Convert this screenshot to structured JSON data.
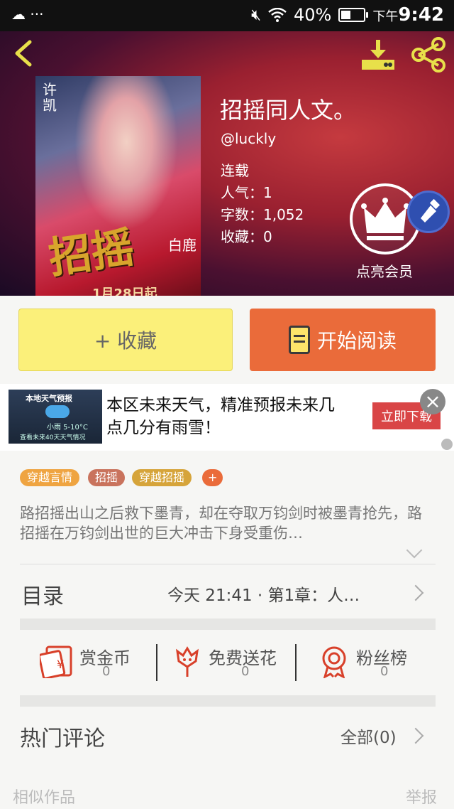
{
  "status_bar": {
    "left_icons": "☁ ···",
    "battery": "40%",
    "time_prefix": "下午",
    "time": "9:42"
  },
  "cover": {
    "title_art": "招摇",
    "date_art": "1月28日起",
    "name_left": "许凯",
    "name_right": "白鹿"
  },
  "book": {
    "title": "招摇同人文。",
    "author": "@luckly",
    "status": "连载",
    "popularity": "人气：1",
    "word_count": "字数：1,052",
    "favorites": "收藏：0"
  },
  "member": {
    "label": "点亮会员"
  },
  "actions": {
    "collect": "+  收藏",
    "read": "开始阅读"
  },
  "ad": {
    "image_title": "本地天气预报",
    "image_sub": "小雨  5-10°C",
    "image_foot": "查看未来40天天气情况",
    "text": "本区未来天气，精准预报未来几点几分有雨雪！",
    "cta": "立即下载",
    "close": "×"
  },
  "tags": [
    {
      "label": "穿越言情",
      "color": "#efa441"
    },
    {
      "label": "招摇",
      "color": "#c9735d"
    },
    {
      "label": "穿越招摇",
      "color": "#d6a43a"
    },
    {
      "label": "+",
      "color": "#ea6b3a"
    }
  ],
  "synopsis": "路招摇出山之后救下墨青，却在夺取万钧剑时被墨青抢先，路招摇在万钧剑出世的巨大冲击下身受重伤…",
  "toc": {
    "label": "目录",
    "latest": "今天 21:41 · 第1章：人…"
  },
  "stats": [
    {
      "label": "赏金币",
      "value": "0",
      "icon": "red-envelope-icon"
    },
    {
      "label": "免费送花",
      "value": "0",
      "icon": "flower-icon"
    },
    {
      "label": "粉丝榜",
      "value": "0",
      "icon": "medal-icon"
    }
  ],
  "comments": {
    "label": "热门评论",
    "all": "全部(0)"
  },
  "footer": {
    "similar": "相似作品",
    "report": "举报"
  },
  "colors": {
    "accent_orange": "#ea6b3a",
    "collect_yellow": "#fbf07a",
    "icon_red": "#d8402a",
    "icon_yellow": "#e8e04a"
  }
}
